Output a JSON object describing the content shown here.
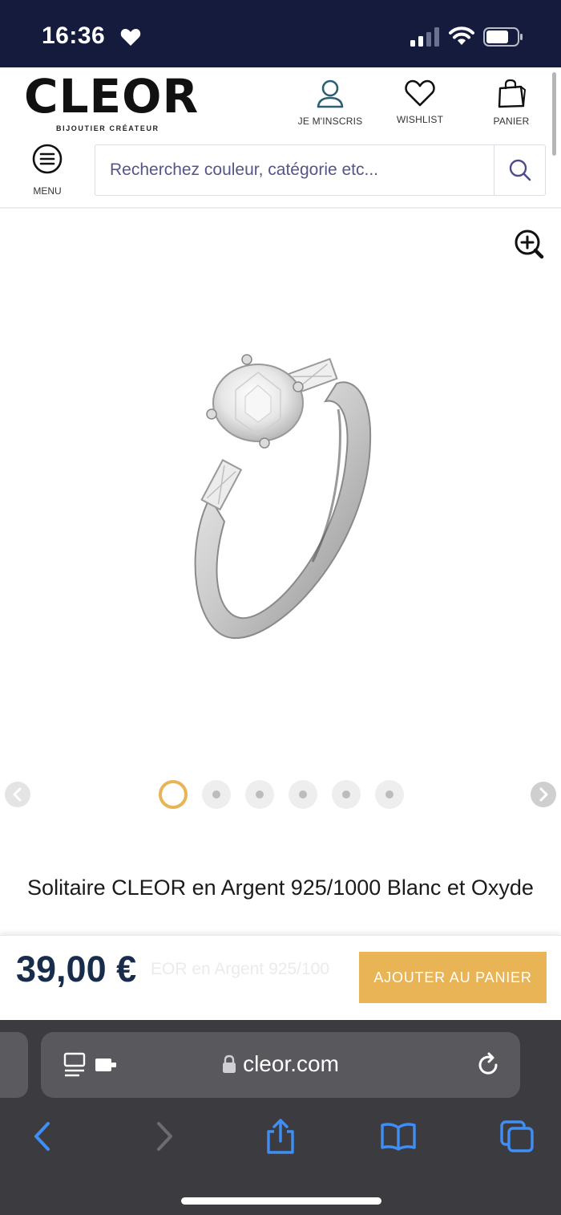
{
  "status_bar": {
    "time": "16:36"
  },
  "header": {
    "logo": "CLEOR",
    "logo_tagline": "BIJOUTIER CRÉATEUR",
    "account_label": "JE M'INSCRIS",
    "wishlist_label": "WISHLIST",
    "cart_label": "PANIER",
    "menu_label": "MENU",
    "search_placeholder": "Recherchez couleur, catégorie etc..."
  },
  "gallery": {
    "slide_count": 6,
    "active_slide": 1
  },
  "product": {
    "title": "Solitaire CLEOR en Argent 925/1000 Blanc et Oxyde",
    "price": "39,00 €",
    "sticky_title_fragment": "EOR en Argent 925/100",
    "add_to_cart_label": "AJOUTER AU PANIER"
  },
  "browser": {
    "url": "cleor.com"
  },
  "colors": {
    "accent": "#e8b456",
    "status_bar_bg": "#141b3c",
    "price_text": "#182c4b",
    "search_text": "#55558a",
    "browser_blue": "#3f8ef5"
  }
}
